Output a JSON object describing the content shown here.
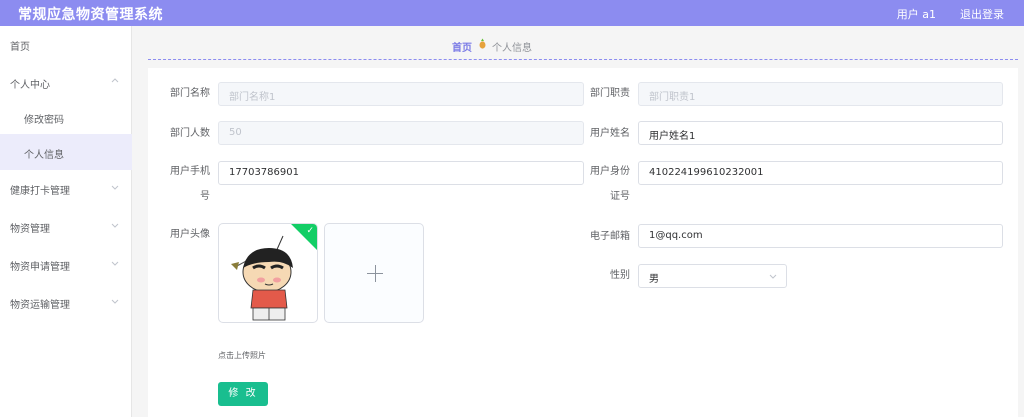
{
  "header": {
    "app_title": "常规应急物资管理系统",
    "user_label": "用户 a1",
    "logout_label": "退出登录"
  },
  "sidebar": {
    "items": [
      {
        "label": "首页"
      },
      {
        "label": "个人中心"
      },
      {
        "label": "修改密码"
      },
      {
        "label": "个人信息"
      },
      {
        "label": "健康打卡管理"
      },
      {
        "label": "物资管理"
      },
      {
        "label": "物资申请管理"
      },
      {
        "label": "物资运输管理"
      }
    ],
    "active_item": "个人信息",
    "chevron_icon": "chevron-down-icon"
  },
  "breadcrumb": {
    "home": "首页",
    "separator_icon": "pineapple-icon",
    "current": "个人信息"
  },
  "form": {
    "dept_name": {
      "label": "部门名称",
      "placeholder": "部门名称1"
    },
    "dept_duty": {
      "label": "部门职责",
      "placeholder": "部门职责1"
    },
    "dept_count": {
      "label": "部门人数",
      "value": "50"
    },
    "user_name": {
      "label": "用户姓名",
      "value": "用户姓名1"
    },
    "user_phone": {
      "label_line1": "用户手机",
      "label_line2": "号",
      "value": "17703786901"
    },
    "user_id": {
      "label_line1": "用户身份",
      "label_line2": "证号",
      "value": "410224199610232001"
    },
    "avatar": {
      "label": "用户头像",
      "upload_tip": "点击上传照片"
    },
    "email": {
      "label": "电子邮箱",
      "value": "1@qq.com"
    },
    "gender": {
      "label": "性别",
      "value": "男"
    },
    "submit_label": "修 改"
  },
  "colors": {
    "header_bg": "#8c8cf0",
    "accent": "#7b7be6",
    "button": "#19be8f",
    "success_badge": "#13ce66"
  }
}
